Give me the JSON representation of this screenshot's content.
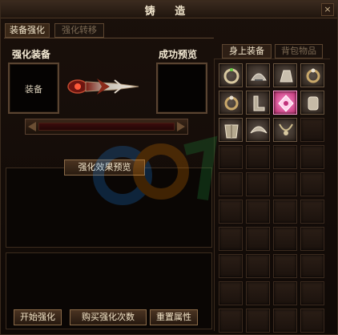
{
  "window": {
    "title": "铸 造",
    "close_label": "×"
  },
  "tabs": [
    {
      "label": "装备强化",
      "active": true
    },
    {
      "label": "强化转移",
      "active": false
    }
  ],
  "left": {
    "enhance_label": "强化装备",
    "preview_label": "成功预览",
    "equip_slot_label": "装备",
    "progress_fraction": 0.0,
    "effect_title": "强化效果预览"
  },
  "buttons": {
    "start": "开始强化",
    "buy": "购买强化次数",
    "reset": "重置属性"
  },
  "inventory": {
    "tabs": [
      {
        "label": "身上装备",
        "active": true
      },
      {
        "label": "背包物品",
        "active": false
      }
    ],
    "rows": 10,
    "cols": 4,
    "items": [
      {
        "index": 0,
        "icon": "bracelet-icon"
      },
      {
        "index": 1,
        "icon": "helmet-icon"
      },
      {
        "index": 2,
        "icon": "gauntlet-icon"
      },
      {
        "index": 3,
        "icon": "ring-icon"
      },
      {
        "index": 4,
        "icon": "ring-icon"
      },
      {
        "index": 5,
        "icon": "boots-icon"
      },
      {
        "index": 6,
        "icon": "amulet-icon",
        "selected": true
      },
      {
        "index": 7,
        "icon": "bracer-icon"
      },
      {
        "index": 8,
        "icon": "armor-icon"
      },
      {
        "index": 9,
        "icon": "shoulder-icon"
      },
      {
        "index": 10,
        "icon": "necklace-icon"
      },
      {
        "index": 22,
        "icon": ""
      },
      {
        "index": 37,
        "icon": ""
      }
    ]
  },
  "colors": {
    "accent": "#a02510",
    "border": "#8a6a48",
    "selected": "#ff8fd0"
  }
}
